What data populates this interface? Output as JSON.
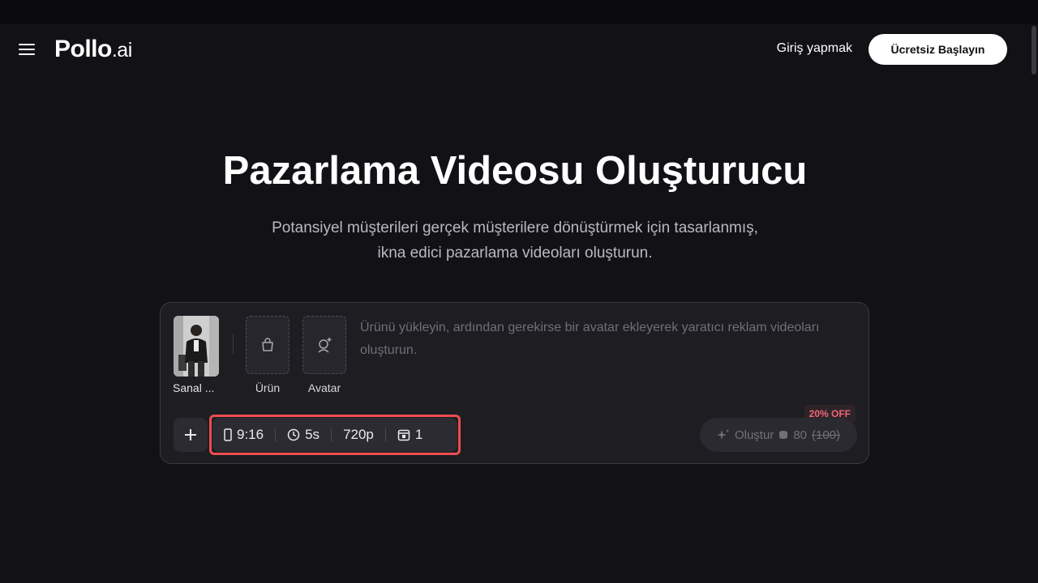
{
  "navbar": {
    "menu_icon": "hamburger-menu-icon",
    "logo_main": "Pollo",
    "logo_suffix": ".ai",
    "login_label": "Giriş yapmak",
    "start_label": "Ücretsiz Başlayın"
  },
  "hero": {
    "title": "Pazarlama Videosu Oluşturucu",
    "subtitle_line1": "Potansiyel müşterileri gerçek müşterilere dönüştürmek için tasarlanmış,",
    "subtitle_line2": "ikna edici pazarlama videoları oluşturun."
  },
  "composer": {
    "avatar_thumb_label": "Sanal ...",
    "product_slot_label": "Ürün",
    "product_icon": "shopping-bag-icon",
    "avatar_slot_label": "Avatar",
    "avatar_icon": "avatar-add-icon",
    "prompt_placeholder": "Ürünü yükleyin, ardından gerekirse bir avatar ekleyerek yaratıcı reklam videoları oluşturun.",
    "plus_icon": "plus-icon",
    "options": {
      "ratio": "9:16",
      "ratio_icon": "phone-portrait-icon",
      "duration": "5s",
      "duration_icon": "clock-icon",
      "resolution": "720p",
      "count": "1",
      "count_icon": "image-stack-icon"
    },
    "generate_label": "Oluştur",
    "generate_icon": "sparkle-icon",
    "credit_icon": "coin-stack-icon",
    "credit_cost": "80",
    "credit_original": "(100)",
    "discount_badge": "20% OFF",
    "highlight_color": "#ec4d50"
  }
}
